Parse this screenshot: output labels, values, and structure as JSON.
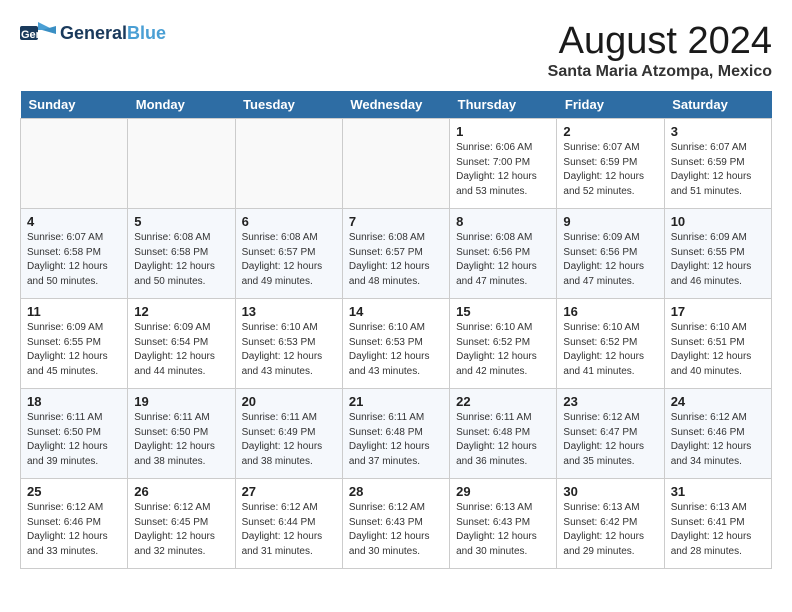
{
  "logo": {
    "text_general": "General",
    "text_blue": "Blue"
  },
  "title": "August 2024",
  "location": "Santa Maria Atzompa, Mexico",
  "days_of_week": [
    "Sunday",
    "Monday",
    "Tuesday",
    "Wednesday",
    "Thursday",
    "Friday",
    "Saturday"
  ],
  "weeks": [
    [
      {
        "day": "",
        "detail": ""
      },
      {
        "day": "",
        "detail": ""
      },
      {
        "day": "",
        "detail": ""
      },
      {
        "day": "",
        "detail": ""
      },
      {
        "day": "1",
        "detail": "Sunrise: 6:06 AM\nSunset: 7:00 PM\nDaylight: 12 hours\nand 53 minutes."
      },
      {
        "day": "2",
        "detail": "Sunrise: 6:07 AM\nSunset: 6:59 PM\nDaylight: 12 hours\nand 52 minutes."
      },
      {
        "day": "3",
        "detail": "Sunrise: 6:07 AM\nSunset: 6:59 PM\nDaylight: 12 hours\nand 51 minutes."
      }
    ],
    [
      {
        "day": "4",
        "detail": "Sunrise: 6:07 AM\nSunset: 6:58 PM\nDaylight: 12 hours\nand 50 minutes."
      },
      {
        "day": "5",
        "detail": "Sunrise: 6:08 AM\nSunset: 6:58 PM\nDaylight: 12 hours\nand 50 minutes."
      },
      {
        "day": "6",
        "detail": "Sunrise: 6:08 AM\nSunset: 6:57 PM\nDaylight: 12 hours\nand 49 minutes."
      },
      {
        "day": "7",
        "detail": "Sunrise: 6:08 AM\nSunset: 6:57 PM\nDaylight: 12 hours\nand 48 minutes."
      },
      {
        "day": "8",
        "detail": "Sunrise: 6:08 AM\nSunset: 6:56 PM\nDaylight: 12 hours\nand 47 minutes."
      },
      {
        "day": "9",
        "detail": "Sunrise: 6:09 AM\nSunset: 6:56 PM\nDaylight: 12 hours\nand 47 minutes."
      },
      {
        "day": "10",
        "detail": "Sunrise: 6:09 AM\nSunset: 6:55 PM\nDaylight: 12 hours\nand 46 minutes."
      }
    ],
    [
      {
        "day": "11",
        "detail": "Sunrise: 6:09 AM\nSunset: 6:55 PM\nDaylight: 12 hours\nand 45 minutes."
      },
      {
        "day": "12",
        "detail": "Sunrise: 6:09 AM\nSunset: 6:54 PM\nDaylight: 12 hours\nand 44 minutes."
      },
      {
        "day": "13",
        "detail": "Sunrise: 6:10 AM\nSunset: 6:53 PM\nDaylight: 12 hours\nand 43 minutes."
      },
      {
        "day": "14",
        "detail": "Sunrise: 6:10 AM\nSunset: 6:53 PM\nDaylight: 12 hours\nand 43 minutes."
      },
      {
        "day": "15",
        "detail": "Sunrise: 6:10 AM\nSunset: 6:52 PM\nDaylight: 12 hours\nand 42 minutes."
      },
      {
        "day": "16",
        "detail": "Sunrise: 6:10 AM\nSunset: 6:52 PM\nDaylight: 12 hours\nand 41 minutes."
      },
      {
        "day": "17",
        "detail": "Sunrise: 6:10 AM\nSunset: 6:51 PM\nDaylight: 12 hours\nand 40 minutes."
      }
    ],
    [
      {
        "day": "18",
        "detail": "Sunrise: 6:11 AM\nSunset: 6:50 PM\nDaylight: 12 hours\nand 39 minutes."
      },
      {
        "day": "19",
        "detail": "Sunrise: 6:11 AM\nSunset: 6:50 PM\nDaylight: 12 hours\nand 38 minutes."
      },
      {
        "day": "20",
        "detail": "Sunrise: 6:11 AM\nSunset: 6:49 PM\nDaylight: 12 hours\nand 38 minutes."
      },
      {
        "day": "21",
        "detail": "Sunrise: 6:11 AM\nSunset: 6:48 PM\nDaylight: 12 hours\nand 37 minutes."
      },
      {
        "day": "22",
        "detail": "Sunrise: 6:11 AM\nSunset: 6:48 PM\nDaylight: 12 hours\nand 36 minutes."
      },
      {
        "day": "23",
        "detail": "Sunrise: 6:12 AM\nSunset: 6:47 PM\nDaylight: 12 hours\nand 35 minutes."
      },
      {
        "day": "24",
        "detail": "Sunrise: 6:12 AM\nSunset: 6:46 PM\nDaylight: 12 hours\nand 34 minutes."
      }
    ],
    [
      {
        "day": "25",
        "detail": "Sunrise: 6:12 AM\nSunset: 6:46 PM\nDaylight: 12 hours\nand 33 minutes."
      },
      {
        "day": "26",
        "detail": "Sunrise: 6:12 AM\nSunset: 6:45 PM\nDaylight: 12 hours\nand 32 minutes."
      },
      {
        "day": "27",
        "detail": "Sunrise: 6:12 AM\nSunset: 6:44 PM\nDaylight: 12 hours\nand 31 minutes."
      },
      {
        "day": "28",
        "detail": "Sunrise: 6:12 AM\nSunset: 6:43 PM\nDaylight: 12 hours\nand 30 minutes."
      },
      {
        "day": "29",
        "detail": "Sunrise: 6:13 AM\nSunset: 6:43 PM\nDaylight: 12 hours\nand 30 minutes."
      },
      {
        "day": "30",
        "detail": "Sunrise: 6:13 AM\nSunset: 6:42 PM\nDaylight: 12 hours\nand 29 minutes."
      },
      {
        "day": "31",
        "detail": "Sunrise: 6:13 AM\nSunset: 6:41 PM\nDaylight: 12 hours\nand 28 minutes."
      }
    ]
  ]
}
